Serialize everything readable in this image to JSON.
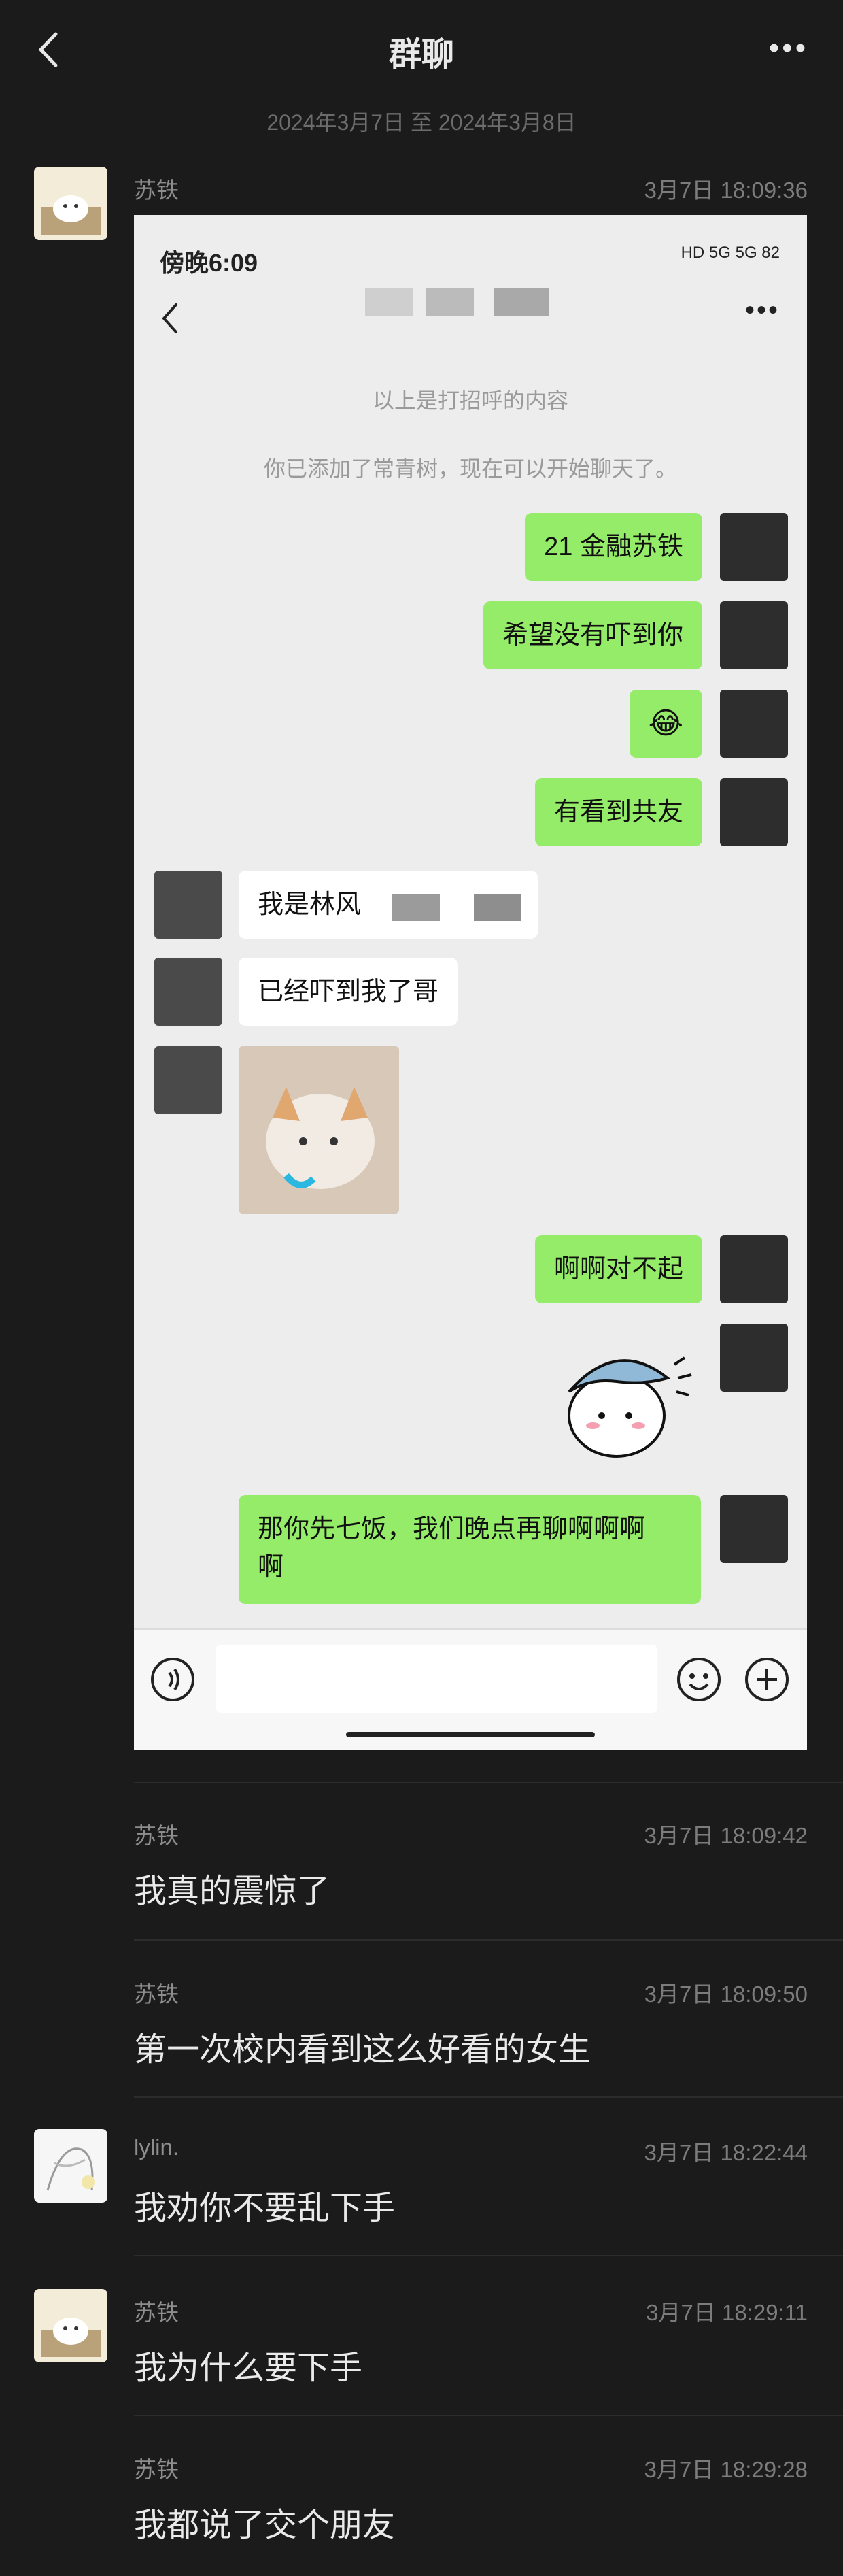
{
  "header": {
    "title": "群聊",
    "more_icon": "more-icon",
    "back_icon": "back-icon"
  },
  "date_range": "2024年3月7日 至 2024年3月8日",
  "messages": [
    {
      "sender": "苏铁",
      "time": "3月7日 18:09:36",
      "type": "image"
    },
    {
      "sender": "苏铁",
      "time": "3月7日 18:09:42",
      "text": "我真的震惊了"
    },
    {
      "sender": "苏铁",
      "time": "3月7日 18:09:50",
      "text": "第一次校内看到这么好看的女生"
    },
    {
      "sender": "lylin.",
      "time": "3月7日 18:22:44",
      "text": "我劝你不要乱下手"
    },
    {
      "sender": "苏铁",
      "time": "3月7日 18:29:11",
      "text": "我为什么要下手"
    },
    {
      "sender": "苏铁",
      "time": "3月7日 18:29:28",
      "text": "我都说了交个朋友"
    }
  ],
  "screenshot": {
    "status_time": "傍晚6:09",
    "status_right": "HD 5G 5G 82",
    "system_1": "以上是打招呼的内容",
    "system_2": "你已添加了常青树，现在可以开始聊天了。",
    "chat": [
      {
        "side": "right",
        "text": "21 金融苏铁"
      },
      {
        "side": "right",
        "text": "希望没有吓到你"
      },
      {
        "side": "right",
        "text": "😂"
      },
      {
        "side": "right",
        "text": "有看到共友"
      },
      {
        "side": "left",
        "text": "我是林风"
      },
      {
        "side": "left",
        "text": "已经吓到我了哥"
      },
      {
        "side": "left",
        "type": "sticker-cat"
      },
      {
        "side": "right",
        "text": "啊啊对不起"
      },
      {
        "side": "right",
        "type": "sticker-character"
      },
      {
        "side": "right",
        "text_line1": "那你先七饭，我们晚点再聊啊啊啊",
        "text_line2": "啊"
      }
    ]
  }
}
